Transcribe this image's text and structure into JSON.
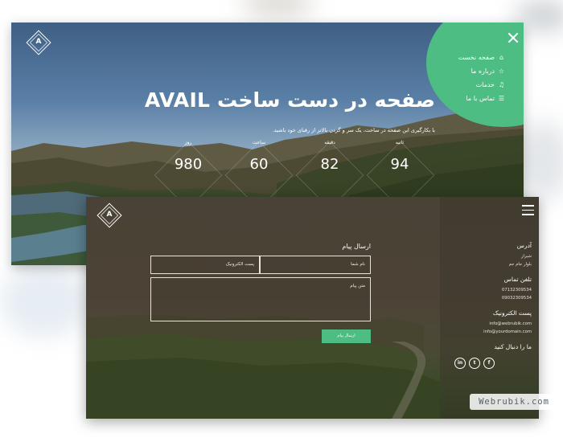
{
  "hero_page": {
    "logo_letter": "A",
    "title": "صفحه در دست ساخت AVAIL",
    "subtitle": "با بکارگیری این صفحه در ساخت، یک سر و گردن بالاتر از رقبای خود باشید.",
    "counters": [
      {
        "label": "روز",
        "value": "980"
      },
      {
        "label": "ساعت",
        "value": "60"
      },
      {
        "label": "دقیقه",
        "value": "82"
      },
      {
        "label": "ثانیه",
        "value": "94"
      }
    ],
    "menu": [
      {
        "label": "صفحه نخست",
        "icon": "home-icon"
      },
      {
        "label": "درباره ما",
        "icon": "star-icon"
      },
      {
        "label": "خدمات",
        "icon": "bell-icon"
      },
      {
        "label": "تماس با ما",
        "icon": "list-icon"
      }
    ],
    "accent_color": "#4dbd84"
  },
  "contact_page": {
    "logo_letter": "A",
    "form": {
      "title": "ارسال پیام",
      "name_placeholder": "نام شما",
      "email_placeholder": "پست الکترونیک",
      "message_placeholder": "متن پیام",
      "send_label": "ارسال پیام"
    },
    "info": {
      "address_heading": "آدرس",
      "address_lines": [
        "شیراز",
        "بلوار جام جم"
      ],
      "phone_heading": "تلفن تماس",
      "phones": [
        "07132309534",
        "09032309534"
      ],
      "email_heading": "پست الکترونیک",
      "emails": [
        "info@webrubik.com",
        "info@yourdomain.com"
      ],
      "follow_heading": "ما را دنبال کنید",
      "social": [
        {
          "icon": "facebook-icon",
          "glyph": "f"
        },
        {
          "icon": "twitter-icon",
          "glyph": "t"
        },
        {
          "icon": "linkedin-icon",
          "glyph": "in"
        }
      ]
    }
  },
  "watermark": "Webrubik.com"
}
